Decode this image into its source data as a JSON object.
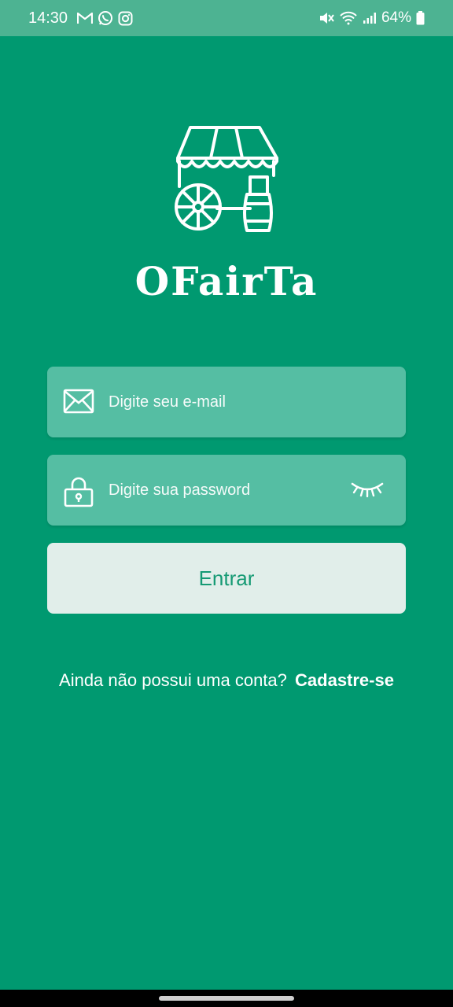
{
  "status_bar": {
    "time": "14:30",
    "left_icons": [
      "gmail-icon",
      "whatsapp-icon",
      "instagram-icon"
    ],
    "right_icons": [
      "mute-icon",
      "wifi-icon",
      "signal-icon"
    ],
    "battery": "64%"
  },
  "app": {
    "brand_name": "OFairTa",
    "logo_icon": "market-stall-cart-icon"
  },
  "login": {
    "email_placeholder": "Digite seu e-mail",
    "password_placeholder": "Digite sua password",
    "submit_label": "Entrar",
    "signup_prompt": "Ainda não possui uma conta?",
    "signup_link": "Cadastre-se"
  },
  "colors": {
    "background": "#009970",
    "status_bar": "#4db392",
    "field_bg": "#55bea3",
    "button_bg": "#e1eeea",
    "button_text": "#159a74"
  }
}
